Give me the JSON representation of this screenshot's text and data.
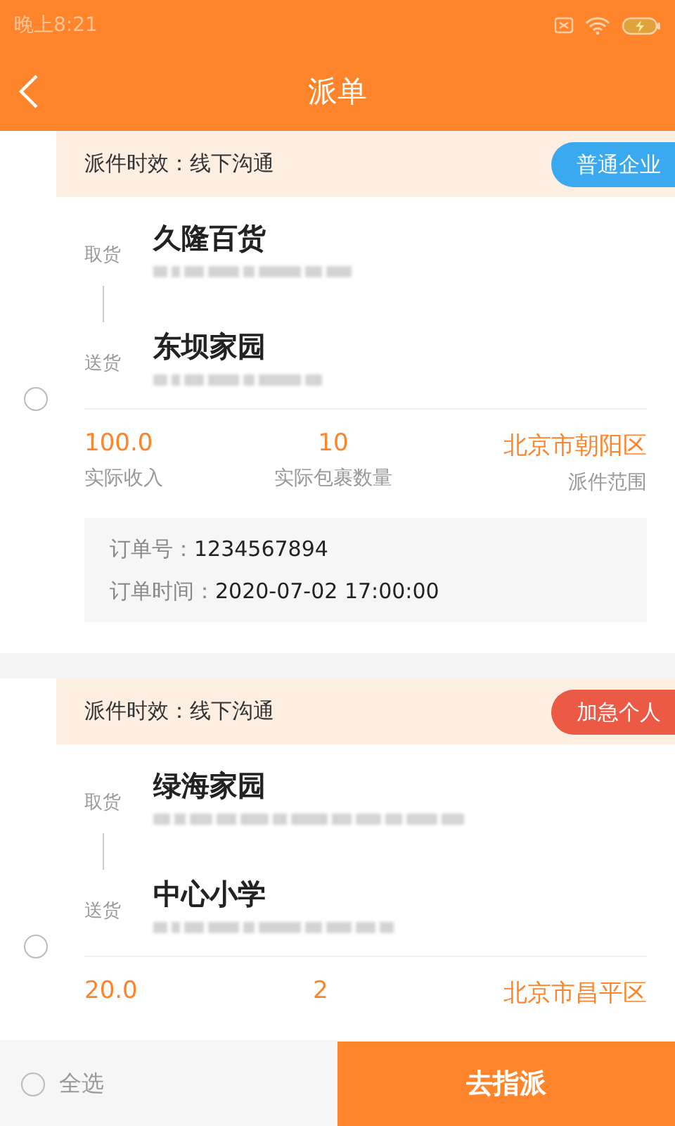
{
  "status_bar": {
    "time": "晚上8:21"
  },
  "nav": {
    "title": "派单"
  },
  "orders": [
    {
      "selected": false,
      "time_label": "派件时效：",
      "time_value": "线下沟通",
      "tag": "普通企业",
      "color": "#3ba9ef",
      "pickup_label": "取货",
      "pickup_name": "久隆百货",
      "deliver_label": "送货",
      "deliver_name": "东坝家园",
      "stats": [
        {
          "value": "100.0",
          "label": "实际收入"
        },
        {
          "value": "10",
          "label": "实际包裹数量"
        },
        {
          "value": "北京市朝阳区",
          "label": "派件范围"
        }
      ],
      "info": [
        {
          "label": "订单号：",
          "value": "1234567894"
        },
        {
          "label": "订单时间：",
          "value": "2020-07-02 17:00:00"
        }
      ]
    },
    {
      "selected": false,
      "time_label": "派件时效：",
      "time_value": "线下沟通",
      "tag": "加急个人",
      "color": "#ec5a45",
      "pickup_label": "取货",
      "pickup_name": "绿海家园",
      "deliver_label": "送货",
      "deliver_name": "中心小学",
      "stats": [
        {
          "value": "20.0"
        },
        {
          "value": "2"
        },
        {
          "value": "北京市昌平区"
        }
      ]
    }
  ],
  "footer": {
    "select_all": "全选",
    "checked": false,
    "button": "去指派"
  }
}
